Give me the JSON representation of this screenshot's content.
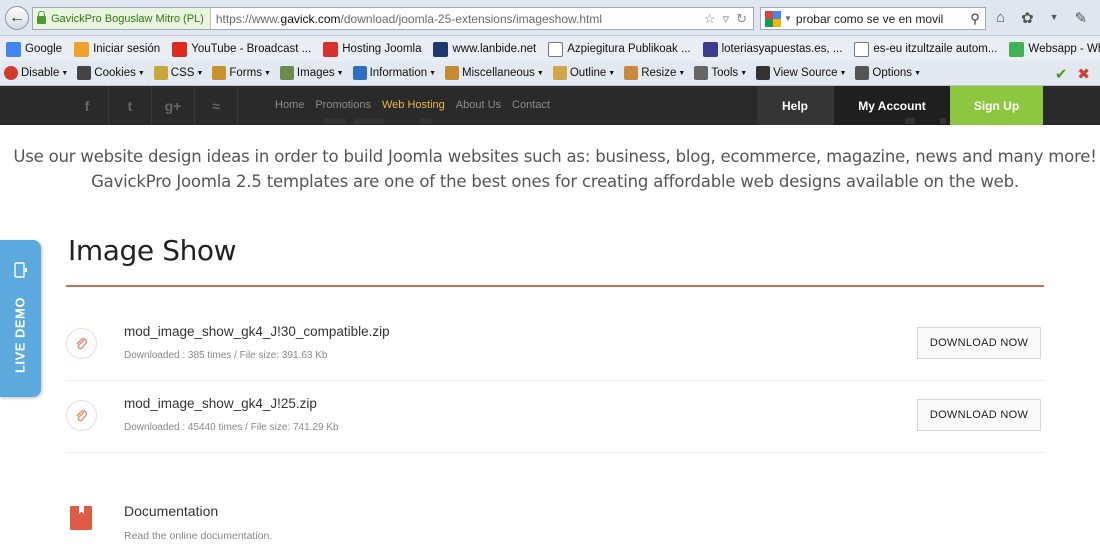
{
  "browser": {
    "identity_label": "GavickPro Boguslaw Mitro (PL)",
    "url_prefix": "https://www.",
    "url_domain": "gavick.com",
    "url_path": "/download/joomla-25-extensions/imageshow.html",
    "search_value": "probar como se ve en movil"
  },
  "bookmarks": [
    {
      "label": "Google",
      "icon": "google-icon",
      "color": "#4285f4"
    },
    {
      "label": "Iniciar sesión",
      "icon": "windows-icon",
      "color": "#f0a22e"
    },
    {
      "label": "YouTube - Broadcast ...",
      "icon": "youtube-icon",
      "color": "#e02a20"
    },
    {
      "label": "Hosting Joomla",
      "icon": "joomla-icon",
      "color": "#d8302c"
    },
    {
      "label": "www.lanbide.net",
      "icon": "globe-icon",
      "color": "#1c3a6b"
    },
    {
      "label": "Azpiegitura Publikoak ...",
      "icon": "page-icon",
      "color": "#ffffff"
    },
    {
      "label": "loteriasyapuestas.es, ...",
      "icon": "lottery-icon",
      "color": "#3b3b8f"
    },
    {
      "label": "es-eu itzultzaile autom...",
      "icon": "page-icon",
      "color": "#ffffff"
    },
    {
      "label": "Websapp - Whatsapp ...",
      "icon": "whatsapp-icon",
      "color": "#3fb34f"
    }
  ],
  "toolbar": [
    {
      "label": "Disable",
      "icon": "disable-icon",
      "color": "#d23b2a"
    },
    {
      "label": "Cookies",
      "icon": "cookies-icon",
      "color": "#444444"
    },
    {
      "label": "CSS",
      "icon": "css-icon",
      "color": "#c9a83a"
    },
    {
      "label": "Forms",
      "icon": "forms-icon",
      "color": "#c8922f"
    },
    {
      "label": "Images",
      "icon": "images-icon",
      "color": "#6f8a4a"
    },
    {
      "label": "Information",
      "icon": "information-icon",
      "color": "#2d6fc1"
    },
    {
      "label": "Miscellaneous",
      "icon": "miscellaneous-icon",
      "color": "#c58a34"
    },
    {
      "label": "Outline",
      "icon": "outline-icon",
      "color": "#d4a64a"
    },
    {
      "label": "Resize",
      "icon": "resize-icon",
      "color": "#c98a3e"
    },
    {
      "label": "Tools",
      "icon": "tools-icon",
      "color": "#666666"
    },
    {
      "label": "View Source",
      "icon": "view-source-icon",
      "color": "#333333"
    },
    {
      "label": "Options",
      "icon": "options-icon",
      "color": "#555555"
    }
  ],
  "site": {
    "nav": [
      "Home",
      "Promotions",
      "Web Hosting",
      "About Us",
      "Contact"
    ],
    "nav_active": "Web Hosting",
    "help_label": "Help",
    "account_label": "My Account",
    "signup_label": "Sign Up",
    "signup_color": "#8dc63f",
    "accent_color": "#c87058"
  },
  "intro": {
    "line1": "Use our website design ideas in order to build Joomla websites such as: business, blog, ecommerce, magazine, news and many more!",
    "line2": "GavickPro Joomla 2.5 templates are one of the best ones for creating affordable web designs available on the web."
  },
  "page": {
    "title": "Image Show"
  },
  "downloads": [
    {
      "file_name": "mod_image_show_gk4_J!30_compatible.zip",
      "meta": "Downloaded : 385 times / File size: 391.63 Kb",
      "button_label": "DOWNLOAD NOW"
    },
    {
      "file_name": "mod_image_show_gk4_J!25.zip",
      "meta": "Downloaded : 45440 times / File size: 741.29 Kb",
      "button_label": "DOWNLOAD NOW"
    }
  ],
  "documentation": {
    "title": "Documentation",
    "subtitle": "Read the online documentation."
  },
  "live_demo": {
    "label": "LIVE DEMO",
    "color": "#5ca9dd"
  }
}
